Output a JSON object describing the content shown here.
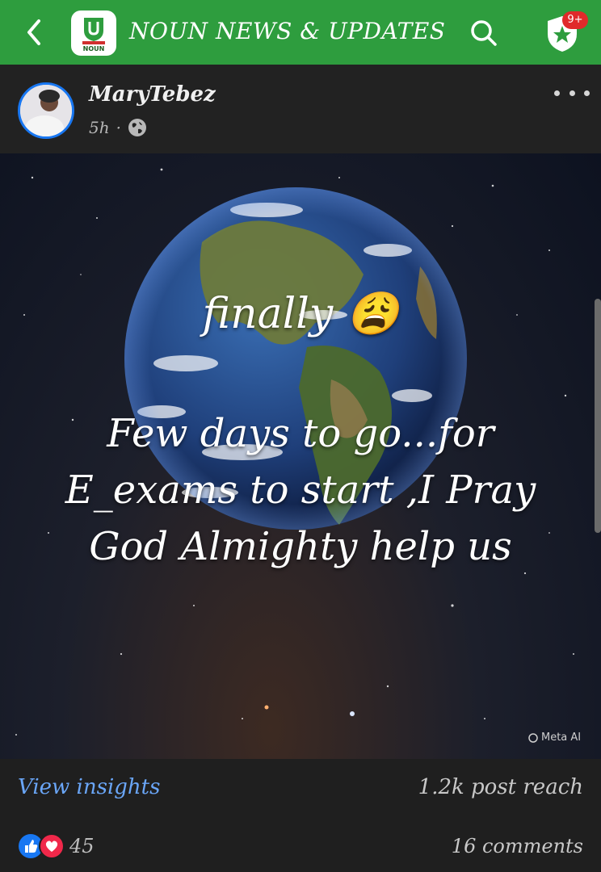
{
  "header": {
    "title": "NOUN NEWS & UPDATES",
    "logo_text": "NOUN",
    "notification_badge": "9+",
    "icons": [
      "back-arrow-icon",
      "search-icon",
      "shield-star-icon"
    ],
    "colors": {
      "bar": "#2e9d3e",
      "badge": "#e02a2a"
    }
  },
  "post": {
    "author": "MaryTebez",
    "time": "5h",
    "separator": "·",
    "visibility_icon": "globe-icon",
    "image": {
      "line1": "finally 😩",
      "line2": "Few days to go...for E_exams to start ,I Pray God Almighty help us",
      "watermark": "Meta AI"
    }
  },
  "footer": {
    "view_insights": "View insights",
    "post_reach": "1.2k post reach",
    "reaction_count": "45",
    "comments": "16 comments",
    "reaction_icons": [
      "like-icon",
      "love-icon"
    ]
  }
}
